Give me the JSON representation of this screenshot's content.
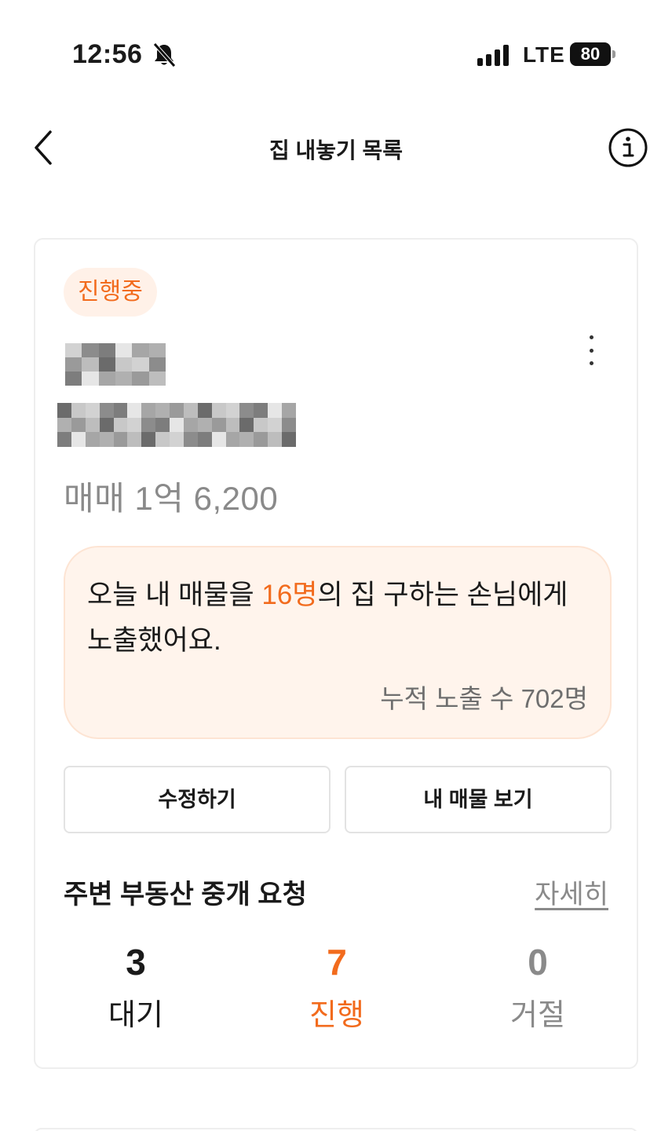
{
  "status_bar": {
    "time": "12:56",
    "network": "LTE",
    "battery": "80"
  },
  "header": {
    "title": "집 내놓기 목록"
  },
  "listing": {
    "status_badge": "진행중",
    "price": "매매 1억 6,200",
    "exposure": {
      "prefix": "오늘 내 매물을 ",
      "count": "16명",
      "suffix": "의 집 구하는 손님에게 노출했어요.",
      "total": "누적 노출 수 702명"
    },
    "buttons": {
      "edit": "수정하기",
      "view": "내 매물 보기"
    },
    "broker_requests": {
      "title": "주변 부동산 중개 요청",
      "detail_link": "자세히",
      "stats": [
        {
          "count": "3",
          "label": "대기"
        },
        {
          "count": "7",
          "label": "진행"
        },
        {
          "count": "0",
          "label": "거절"
        }
      ]
    }
  },
  "colors": {
    "accent": "#f26b1d",
    "badge_bg": "#fff1e8",
    "exposure_bg": "#fff4ec",
    "muted": "#8a8a8a"
  }
}
